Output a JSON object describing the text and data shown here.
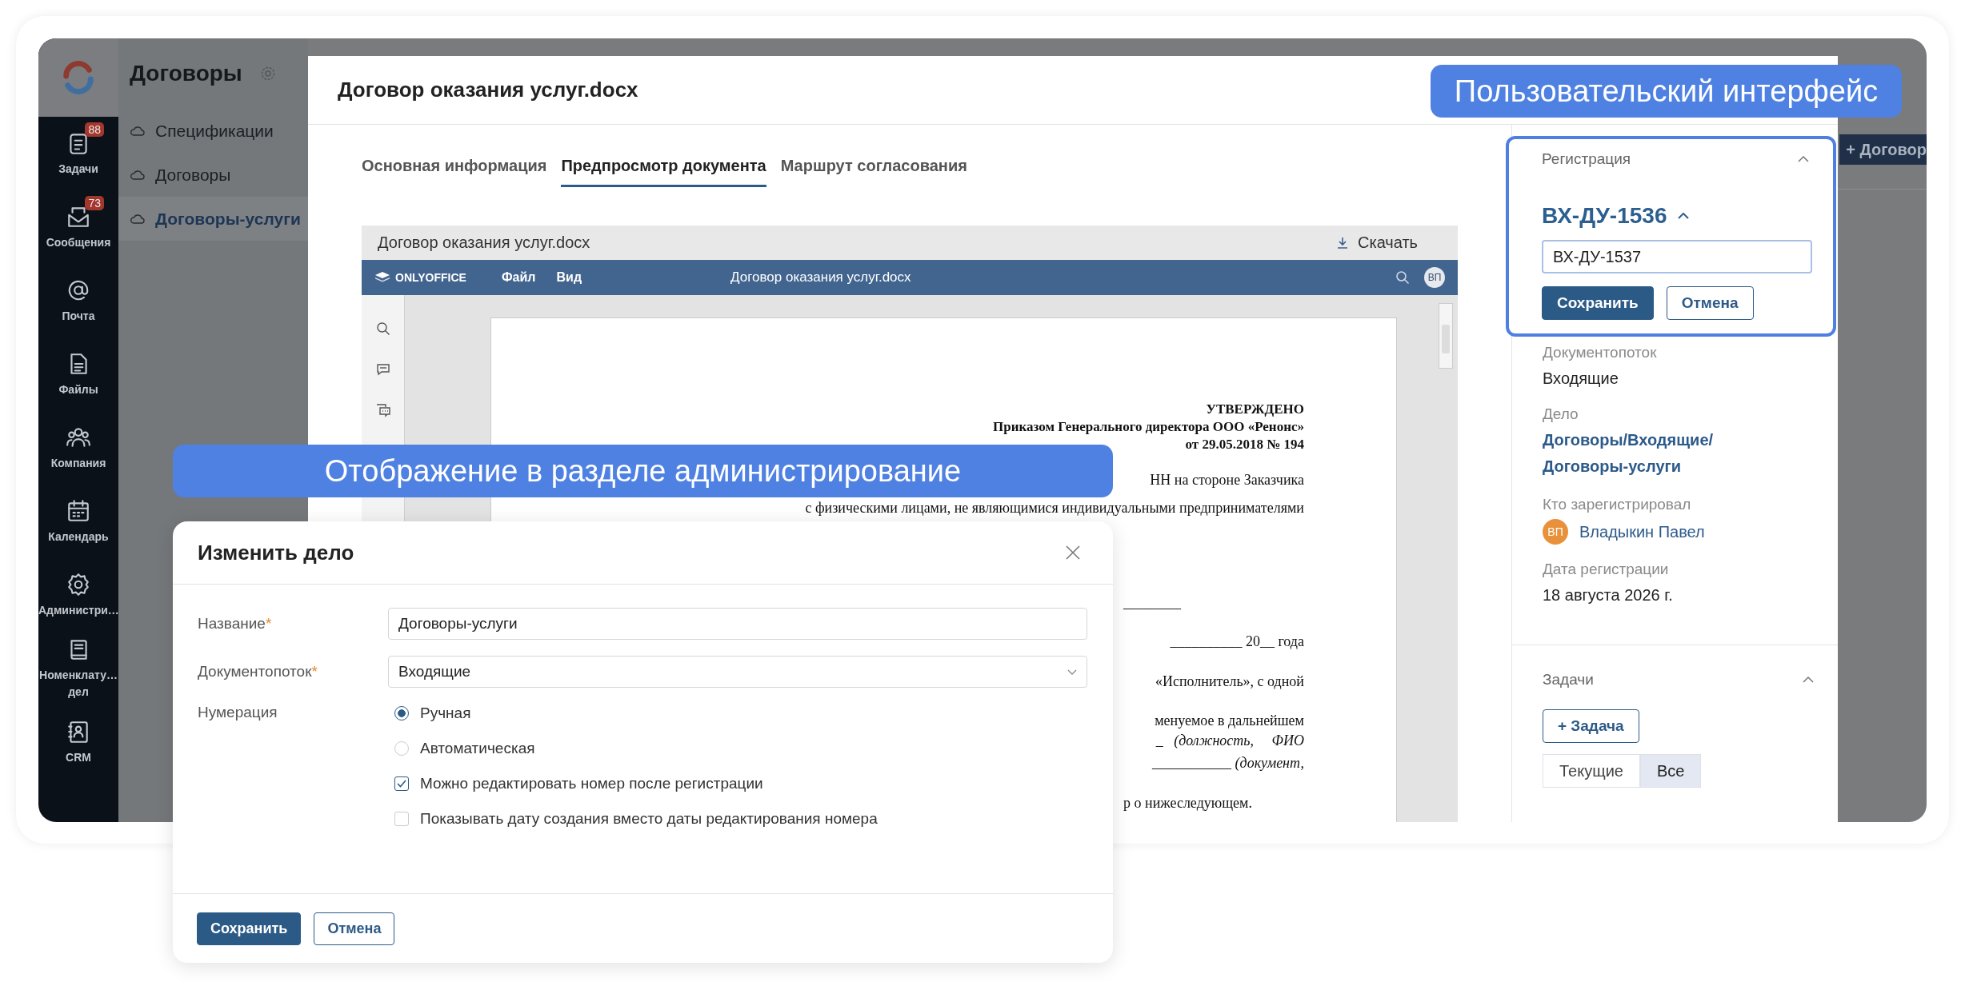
{
  "callouts": [
    {
      "text": "Пользовательский интерфейс"
    },
    {
      "text": "Отображение в разделе администрирование"
    }
  ],
  "app_rail": {
    "items": [
      {
        "label": "Задачи",
        "badge": "88"
      },
      {
        "label": "Сообщения",
        "badge": "73"
      },
      {
        "label": "Почта"
      },
      {
        "label": "Файлы"
      },
      {
        "label": "Компания"
      },
      {
        "label": "Календарь"
      },
      {
        "label": "Администри…"
      },
      {
        "label": "Номенклату… дел"
      },
      {
        "label": "CRM"
      }
    ]
  },
  "section_sidebar": {
    "title": "Договоры",
    "items": [
      {
        "label": "Спецификации",
        "selected": false
      },
      {
        "label": "Договоры",
        "selected": false
      },
      {
        "label": "Договоры-услуги",
        "selected": true
      }
    ]
  },
  "background_button": {
    "label": "+ Договор"
  },
  "document_modal": {
    "title": "Договор оказания услуг.docx",
    "tabs": [
      {
        "label": "Основная информация",
        "selected": false
      },
      {
        "label": "Предпросмотр документа",
        "selected": true
      },
      {
        "label": "Маршрут согласования",
        "selected": false
      }
    ],
    "preview": {
      "title": "Договор оказания услуг.docx",
      "download": "Скачать",
      "editor": {
        "brand": "ONLYOFFICE",
        "menu": [
          "Файл",
          "Вид"
        ],
        "title": "Договор оказания услуг.docx",
        "avatar": "ВП"
      },
      "lines": [
        {
          "kind": "approval",
          "text": "УТВЕРЖДЕНО"
        },
        {
          "kind": "approval",
          "text": "Приказом Генерального директора ООО «Ренонс»"
        },
        {
          "kind": "approval",
          "text": "от 29.05.2018 № 194"
        },
        {
          "kind": "justified",
          "text": "НН на стороне Заказчика"
        },
        {
          "kind": "justified",
          "text": "с физическими лицами, не являющимися индивидуальными предпринимателями"
        },
        {
          "kind": "start",
          "text": "________"
        },
        {
          "kind": "justified",
          "text": "__________ 20__ года"
        },
        {
          "kind": "justified",
          "text": "«Исполнитель», с одной"
        },
        {
          "kind": "justified",
          "text": "менуемое в дальнейшем"
        },
        {
          "kind": "justified",
          "text": "_   *(должность,     ФИО*"
        },
        {
          "kind": "justified",
          "text": "___________ *(документ,*"
        },
        {
          "kind": "start",
          "text": "р о нижеследующем."
        }
      ]
    },
    "registration": {
      "title": "Регистрация",
      "expanded": true,
      "number": "ВХ-ДУ-1536",
      "input_value": "ВХ-ДУ-1537",
      "save": "Сохранить",
      "cancel": "Отмена"
    },
    "details": [
      {
        "kind": "text",
        "label": "Документопоток",
        "value": "Входящие"
      },
      {
        "kind": "link",
        "label": "Дело",
        "value": "Договоры/Входящие/Договоры-услуги"
      },
      {
        "kind": "person",
        "label": "Кто зарегистрировал",
        "value": "Владыкин Павел",
        "avatar": "ВП"
      },
      {
        "kind": "text",
        "label": "Дата регистрации",
        "value": "18 августа 2026 г."
      }
    ],
    "tasks": {
      "title": "Задачи",
      "expanded": true,
      "add": "+ Задача",
      "filters": [
        {
          "label": "Текущие",
          "selected": false
        },
        {
          "label": "Все",
          "selected": true
        }
      ]
    }
  },
  "admin_dialog": {
    "title": "Изменить дело",
    "fields": [
      {
        "kind": "input",
        "label": "Название",
        "required_mark": "*",
        "value": "Договоры-услуги"
      },
      {
        "kind": "select",
        "label": "Документопоток",
        "required_mark": "*",
        "value": "Входящие"
      }
    ],
    "numbering": {
      "label": "Нумерация",
      "options": [
        {
          "label": "Ручная",
          "selected": true
        },
        {
          "label": "Автоматическая",
          "selected": false
        }
      ],
      "checkboxes": [
        {
          "label": "Можно редактировать номер после регистрации",
          "checked": true
        },
        {
          "label": "Показывать дату создания вместо даты редактирования номера",
          "checked": false
        }
      ]
    },
    "save": "Сохранить",
    "cancel": "Отмена"
  }
}
